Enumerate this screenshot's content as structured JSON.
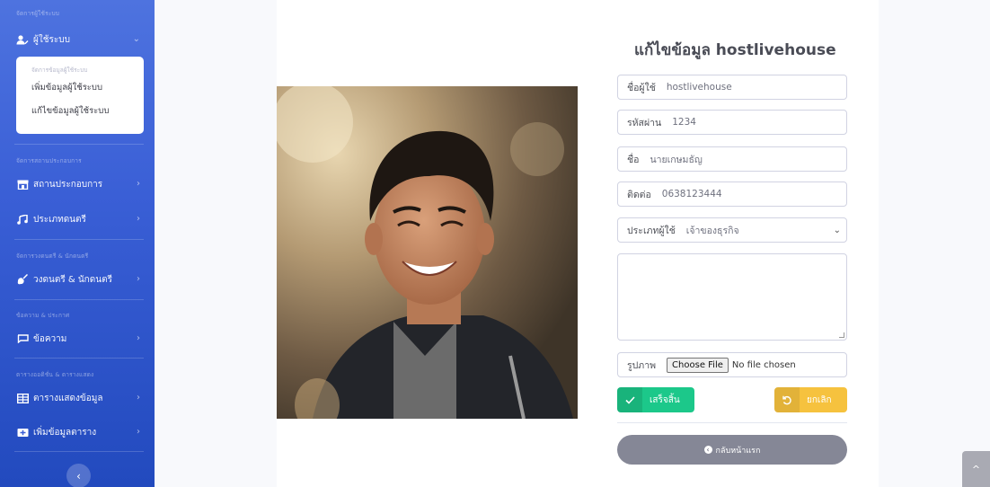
{
  "sidebar": {
    "heading_users": "จัดการผู้ใช้ระบบ",
    "users_item": "ผู้ใช้ระบบ",
    "users_submenu": {
      "heading": "จัดการข้อมูลผู้ใช้ระบบ",
      "items": [
        "เพิ่มข้อมูลผู้ใช้ระบบ",
        "แก้ไขข้อมูลผู้ใช้ระบบ"
      ]
    },
    "heading_venue": "จัดการสถานประกอบการ",
    "venue_item": "สถานประกอบการ",
    "music_type_item": "ประเภทดนตรี",
    "heading_bands": "จัดการวงดนตรี & นักดนตรี",
    "bands_item": "วงดนตรี & นักดนตรี",
    "heading_messages": "ข้อความ & ประกาศ",
    "messages_item": "ข้อความ",
    "heading_tables": "ตารางออดิชั่น & ตารางแสดง",
    "tables_item": "ตารางแสดงข้อมูล",
    "add_table_item": "เพิ่มข้อมูลตาราง"
  },
  "form": {
    "title": "แก้ไขข้อมูล hostlivehouse",
    "username_label": "ชื่อผู้ใช้",
    "username_value": "hostlivehouse",
    "password_label": "รหัสผ่าน",
    "password_value": "1234",
    "name_label": "ชื่อ",
    "name_value": "นายเกษมธัญ",
    "contact_label": "ติดต่อ",
    "contact_value": "0638123444",
    "user_type_label": "ประเภทผู้ใช้",
    "user_type_value": "เจ้าของธุรกิจ",
    "image_label": "รูปภาพ",
    "choose_file": "Choose File",
    "no_file": "No file chosen",
    "submit_label": "เสร็จสิ้น",
    "cancel_label": "ยกเลิก",
    "back_label": "กลับหน้าแรก"
  },
  "colors": {
    "sidebar": "#4e73df",
    "success": "#1cc88a",
    "warning": "#f6c23e",
    "secondary": "#858796"
  }
}
